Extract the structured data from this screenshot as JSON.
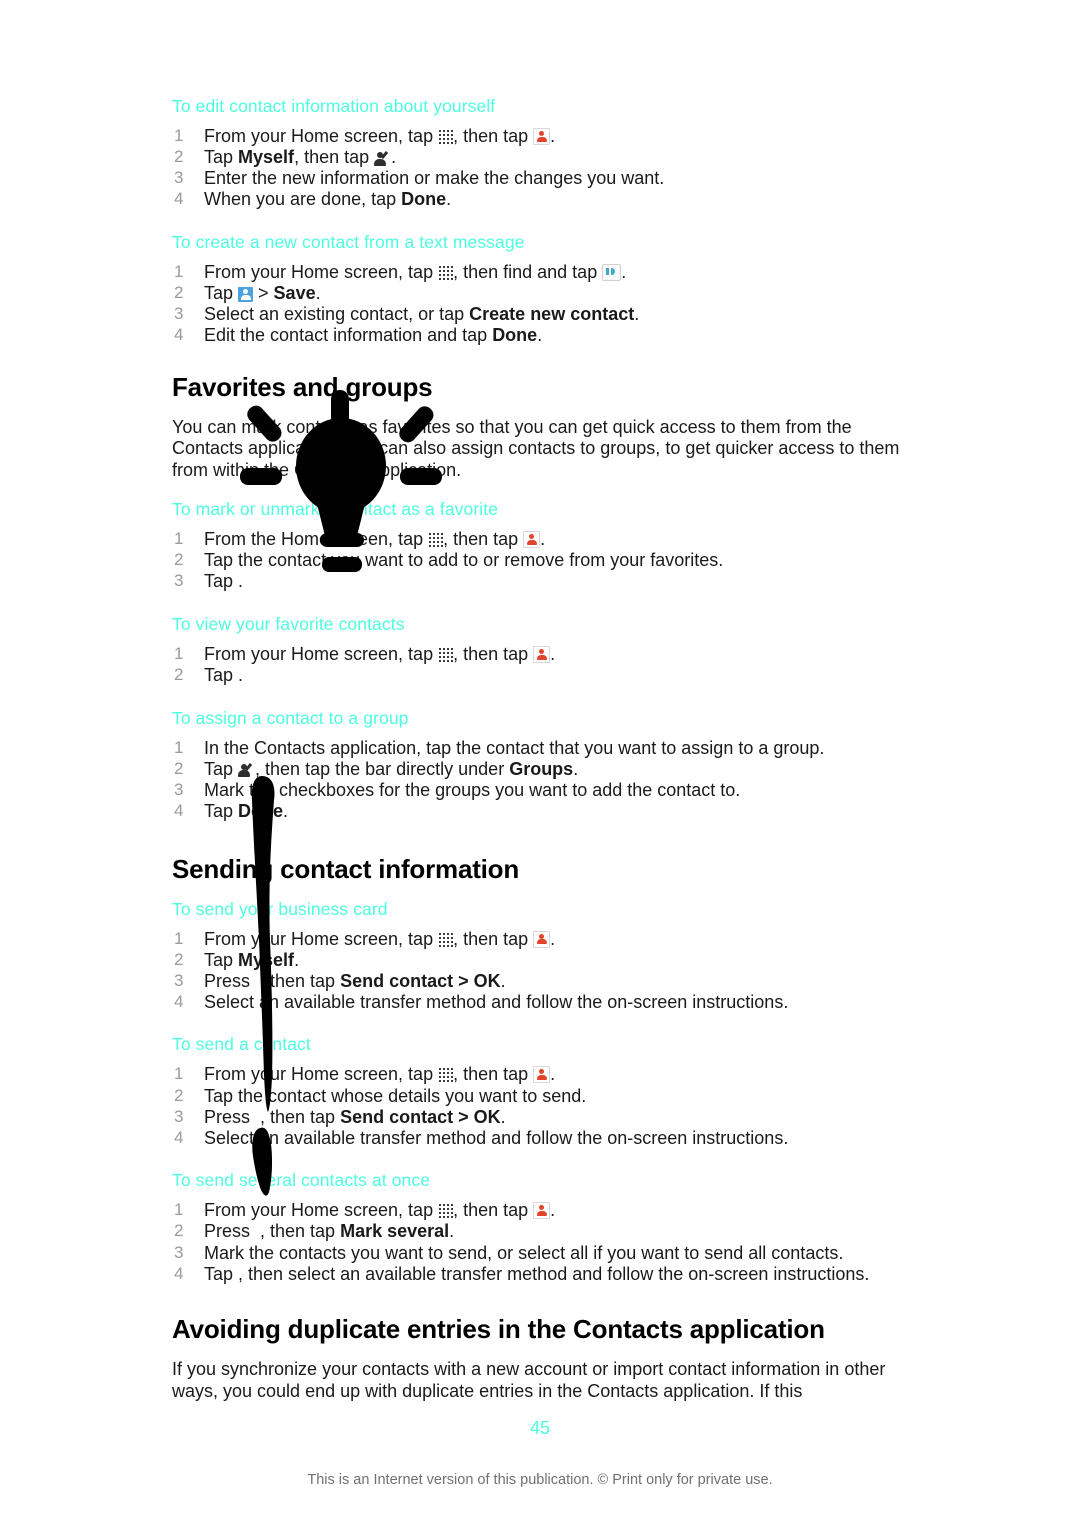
{
  "document": {
    "page_number": "45",
    "footer_note": "This is an Internet version of this publication. © Print only for private use.",
    "accent_color": "#4dffe0",
    "number_color": "#9a9a9a",
    "annotation_color": "#000000"
  },
  "sections": [
    {
      "id": "edit-contact-info",
      "type": "procedure",
      "heading": "To edit contact information about yourself",
      "steps": [
        {
          "num": "1",
          "parts": [
            {
              "t": "text",
              "v": "From your Home screen, tap "
            },
            {
              "t": "icon",
              "v": "app-drawer-icon"
            },
            {
              "t": "text",
              "v": ", then tap "
            },
            {
              "t": "icon",
              "v": "contacts-icon"
            },
            {
              "t": "text",
              "v": "."
            }
          ]
        },
        {
          "num": "2",
          "parts": [
            {
              "t": "text",
              "v": "Tap "
            },
            {
              "t": "bold",
              "v": "Myself"
            },
            {
              "t": "text",
              "v": ", then tap "
            },
            {
              "t": "icon",
              "v": "edit-contact-icon"
            },
            {
              "t": "text",
              "v": "."
            }
          ]
        },
        {
          "num": "3",
          "parts": [
            {
              "t": "text",
              "v": "Enter the new information or make the changes you want."
            }
          ]
        },
        {
          "num": "4",
          "parts": [
            {
              "t": "text",
              "v": "When you are done, tap "
            },
            {
              "t": "bold",
              "v": "Done"
            },
            {
              "t": "text",
              "v": "."
            }
          ]
        }
      ]
    },
    {
      "id": "create-contact-from-text",
      "type": "procedure",
      "heading": "To create a new contact from a text message",
      "steps": [
        {
          "num": "1",
          "parts": [
            {
              "t": "text",
              "v": "From your Home screen, tap "
            },
            {
              "t": "icon",
              "v": "app-drawer-icon"
            },
            {
              "t": "text",
              "v": ", then find and tap "
            },
            {
              "t": "icon",
              "v": "messaging-icon"
            },
            {
              "t": "text",
              "v": "."
            }
          ]
        },
        {
          "num": "2",
          "parts": [
            {
              "t": "text",
              "v": "Tap "
            },
            {
              "t": "icon",
              "v": "blue-contact-icon"
            },
            {
              "t": "text",
              "v": " > "
            },
            {
              "t": "bold",
              "v": "Save"
            },
            {
              "t": "text",
              "v": "."
            }
          ]
        },
        {
          "num": "3",
          "parts": [
            {
              "t": "text",
              "v": "Select an existing contact, or tap "
            },
            {
              "t": "bold",
              "v": "Create new contact"
            },
            {
              "t": "text",
              "v": "."
            }
          ]
        },
        {
          "num": "4",
          "parts": [
            {
              "t": "text",
              "v": "Edit the contact information and tap "
            },
            {
              "t": "bold",
              "v": "Done"
            },
            {
              "t": "text",
              "v": "."
            }
          ]
        }
      ]
    },
    {
      "id": "favorites-and-groups",
      "type": "heading",
      "title": "Favorites and groups",
      "body": "You can mark contacts as favorites so that you can get quick access to them from the Contacts application. You can also assign contacts to groups, to get quicker access to them from within the Contacts application."
    },
    {
      "id": "mark-unmark-favorite",
      "type": "procedure",
      "heading": "To mark or unmark a contact as a favorite",
      "steps": [
        {
          "num": "1",
          "parts": [
            {
              "t": "text",
              "v": "From the Home screen, tap "
            },
            {
              "t": "icon",
              "v": "app-drawer-icon"
            },
            {
              "t": "text",
              "v": ", then tap "
            },
            {
              "t": "icon",
              "v": "contacts-icon"
            },
            {
              "t": "text",
              "v": "."
            }
          ]
        },
        {
          "num": "2",
          "parts": [
            {
              "t": "text",
              "v": "Tap the contact you want to add to or remove from your favorites."
            }
          ]
        },
        {
          "num": "3",
          "parts": [
            {
              "t": "text",
              "v": "Tap  ."
            }
          ]
        }
      ]
    },
    {
      "id": "view-favorite-contacts",
      "type": "procedure",
      "heading": "To view your favorite contacts",
      "steps": [
        {
          "num": "1",
          "parts": [
            {
              "t": "text",
              "v": "From your Home screen, tap "
            },
            {
              "t": "icon",
              "v": "app-drawer-icon"
            },
            {
              "t": "text",
              "v": ", then tap "
            },
            {
              "t": "icon",
              "v": "contacts-icon"
            },
            {
              "t": "text",
              "v": "."
            }
          ]
        },
        {
          "num": "2",
          "parts": [
            {
              "t": "text",
              "v": "Tap  ."
            }
          ]
        }
      ]
    },
    {
      "id": "assign-contact-to-group",
      "type": "procedure",
      "heading": "To assign a contact to a group",
      "steps": [
        {
          "num": "1",
          "parts": [
            {
              "t": "text",
              "v": "In the Contacts application, tap the contact that you want to assign to a group."
            }
          ]
        },
        {
          "num": "2",
          "parts": [
            {
              "t": "text",
              "v": "Tap "
            },
            {
              "t": "icon",
              "v": "edit-contact-icon"
            },
            {
              "t": "text",
              "v": ", then tap the bar directly under "
            },
            {
              "t": "bold",
              "v": "Groups"
            },
            {
              "t": "text",
              "v": "."
            }
          ]
        },
        {
          "num": "3",
          "parts": [
            {
              "t": "text",
              "v": "Mark the checkboxes for the groups you want to add the contact to."
            }
          ]
        },
        {
          "num": "4",
          "parts": [
            {
              "t": "text",
              "v": "Tap "
            },
            {
              "t": "bold",
              "v": "Done"
            },
            {
              "t": "text",
              "v": "."
            }
          ]
        }
      ]
    },
    {
      "id": "sending-contact-information",
      "type": "heading",
      "title": "Sending contact information",
      "body": ""
    },
    {
      "id": "send-business-card",
      "type": "procedure",
      "heading": "To send your business card",
      "steps": [
        {
          "num": "1",
          "parts": [
            {
              "t": "text",
              "v": "From your Home screen, tap "
            },
            {
              "t": "icon",
              "v": "app-drawer-icon"
            },
            {
              "t": "text",
              "v": ", then tap "
            },
            {
              "t": "icon",
              "v": "contacts-icon"
            },
            {
              "t": "text",
              "v": "."
            }
          ]
        },
        {
          "num": "2",
          "parts": [
            {
              "t": "text",
              "v": "Tap "
            },
            {
              "t": "bold",
              "v": "Myself"
            },
            {
              "t": "text",
              "v": "."
            }
          ]
        },
        {
          "num": "3",
          "parts": [
            {
              "t": "text",
              "v": "Press  , then tap "
            },
            {
              "t": "bold",
              "v": "Send contact > OK"
            },
            {
              "t": "text",
              "v": "."
            }
          ]
        },
        {
          "num": "4",
          "parts": [
            {
              "t": "text",
              "v": "Select an available transfer method and follow the on-screen instructions."
            }
          ]
        }
      ]
    },
    {
      "id": "send-a-contact",
      "type": "procedure",
      "heading": "To send a contact",
      "steps": [
        {
          "num": "1",
          "parts": [
            {
              "t": "text",
              "v": "From your Home screen, tap "
            },
            {
              "t": "icon",
              "v": "app-drawer-icon"
            },
            {
              "t": "text",
              "v": ", then tap "
            },
            {
              "t": "icon",
              "v": "contacts-icon"
            },
            {
              "t": "text",
              "v": "."
            }
          ]
        },
        {
          "num": "2",
          "parts": [
            {
              "t": "text",
              "v": "Tap the contact whose details you want to send."
            }
          ]
        },
        {
          "num": "3",
          "parts": [
            {
              "t": "text",
              "v": "Press  , then tap "
            },
            {
              "t": "bold",
              "v": "Send contact > OK"
            },
            {
              "t": "text",
              "v": "."
            }
          ]
        },
        {
          "num": "4",
          "parts": [
            {
              "t": "text",
              "v": "Select an available transfer method and follow the on-screen instructions."
            }
          ]
        }
      ]
    },
    {
      "id": "send-several-contacts",
      "type": "procedure",
      "heading": "To send several contacts at once",
      "steps": [
        {
          "num": "1",
          "parts": [
            {
              "t": "text",
              "v": "From your Home screen, tap "
            },
            {
              "t": "icon",
              "v": "app-drawer-icon"
            },
            {
              "t": "text",
              "v": ", then tap "
            },
            {
              "t": "icon",
              "v": "contacts-icon"
            },
            {
              "t": "text",
              "v": "."
            }
          ]
        },
        {
          "num": "2",
          "parts": [
            {
              "t": "text",
              "v": "Press  , then tap "
            },
            {
              "t": "bold",
              "v": "Mark several"
            },
            {
              "t": "text",
              "v": "."
            }
          ]
        },
        {
          "num": "3",
          "parts": [
            {
              "t": "text",
              "v": "Mark the contacts you want to send, or select all if you want to send all contacts."
            }
          ]
        },
        {
          "num": "4",
          "parts": [
            {
              "t": "text",
              "v": "Tap  , then select an available transfer method and follow the on-screen instructions."
            }
          ]
        }
      ]
    },
    {
      "id": "avoiding-duplicate-entries",
      "type": "heading",
      "title": "Avoiding duplicate entries in the Contacts application",
      "body": "If you synchronize your contacts with a new account or import contact information in other ways, you could end up with duplicate entries in the Contacts application. If this"
    }
  ],
  "annotation": {
    "name": "lightbulb-drawing",
    "description": "Hand-drawn black lightbulb with rays and a long vertical stroke",
    "color": "#000000"
  }
}
